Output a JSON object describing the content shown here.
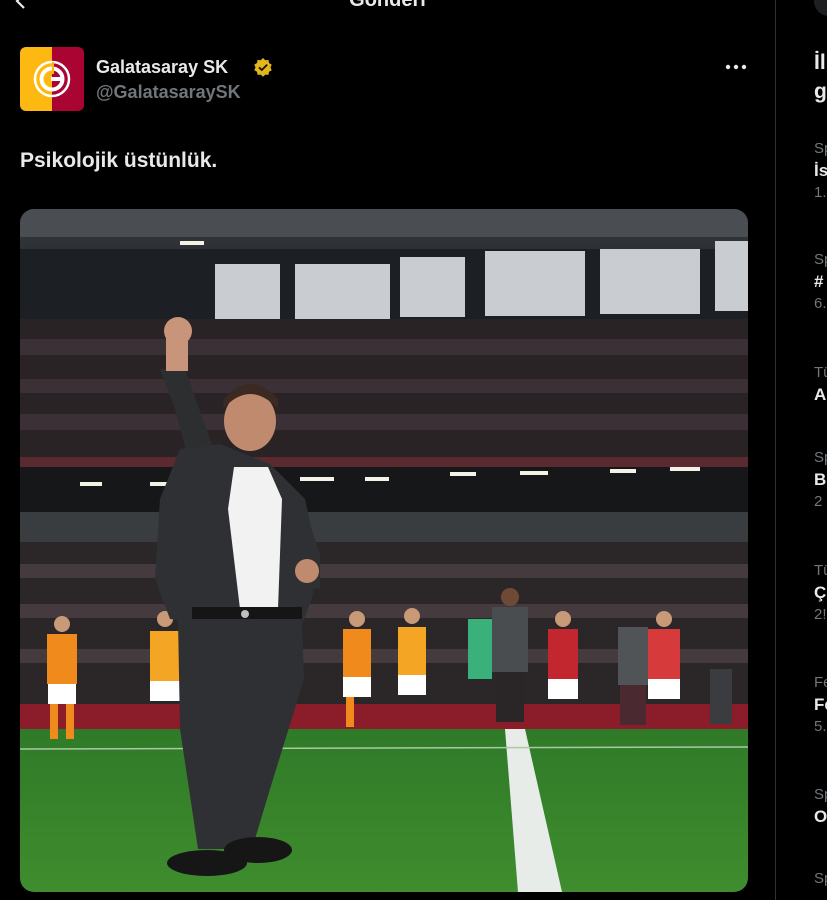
{
  "header": {
    "title": "Gönderi"
  },
  "post": {
    "author_name": "Galatasaray SK",
    "author_handle": "@GalatasaraySK",
    "text": "Psikolojik üstünlük.",
    "image_alt": "Coach raising fist on stadium pitch, players applauding fans in background",
    "icons": {
      "back": "back-arrow-icon",
      "verified": "verified-badge-icon",
      "more": "more-dots-icon"
    },
    "colors": {
      "club_red": "#a90432",
      "club_yellow": "#fdb912",
      "verified_gold": "#e2b719"
    }
  },
  "sidebar": {
    "title_line1": "İl",
    "title_line2": "g",
    "trends": [
      {
        "cat": "Sp",
        "name": "İs",
        "count": "1."
      },
      {
        "cat": "Sp",
        "name": "#",
        "count": "6."
      },
      {
        "cat": "Tü",
        "name": "A",
        "count": ""
      },
      {
        "cat": "Sp",
        "name": "B",
        "count": "2"
      },
      {
        "cat": "Tü",
        "name": "Ç",
        "count": "2!"
      },
      {
        "cat": "Fe",
        "name": "Fe",
        "count": "5."
      },
      {
        "cat": "Sp",
        "name": "O",
        "count": ""
      },
      {
        "cat": "Sp",
        "name": "",
        "count": ""
      }
    ]
  }
}
